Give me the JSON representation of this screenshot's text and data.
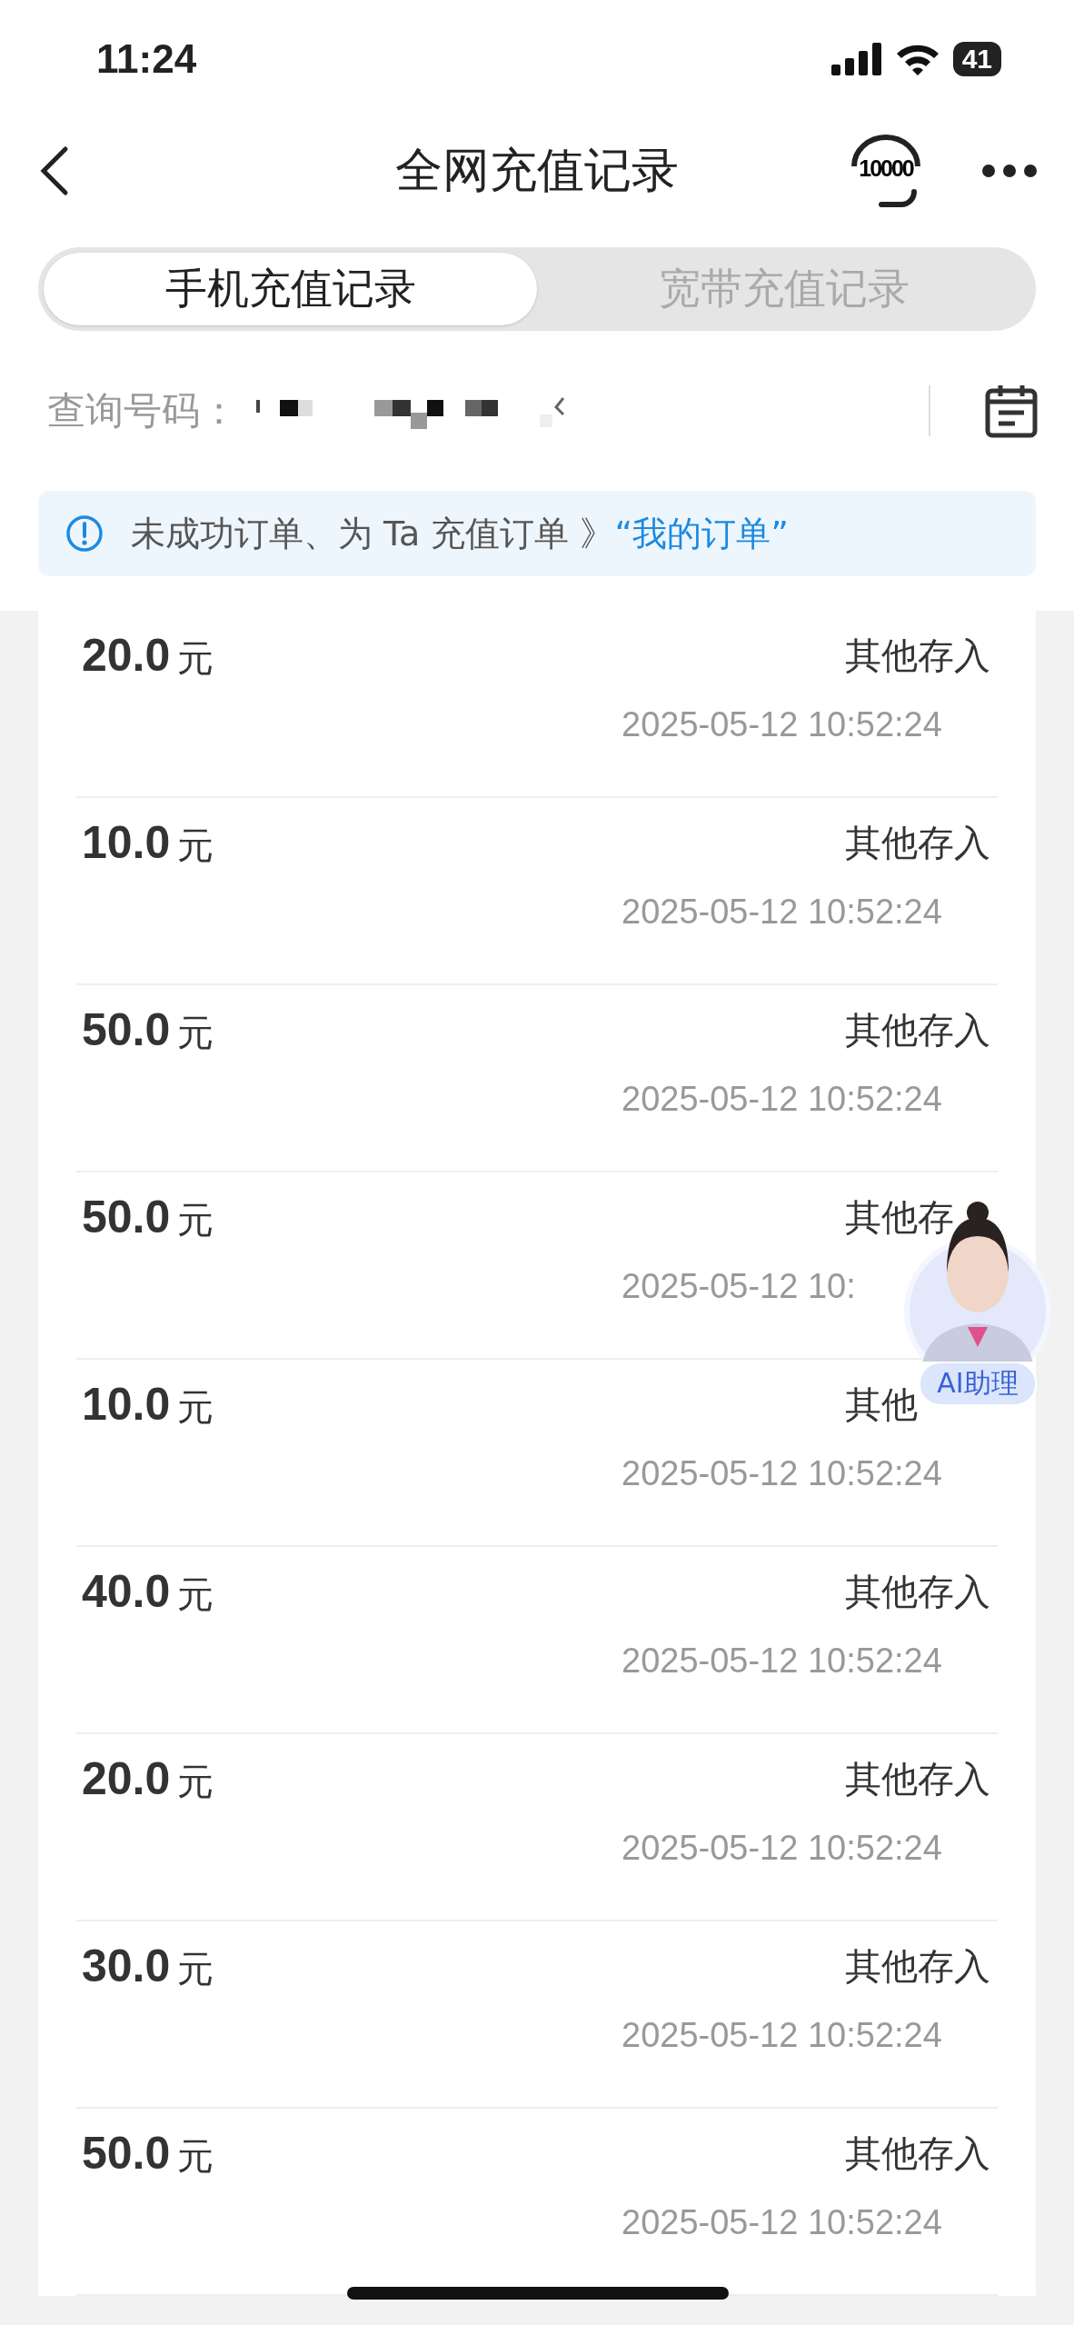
{
  "status_bar": {
    "time": "11:24",
    "battery": "41"
  },
  "header": {
    "title": "全网充值记录",
    "service_label": "10000"
  },
  "tabs": [
    {
      "label": "手机充值记录",
      "selected": true
    },
    {
      "label": "宽带充值记录",
      "selected": false
    }
  ],
  "query": {
    "label": "查询号码："
  },
  "notice": {
    "text": "未成功订单、为 Ta 充值订单 》",
    "link": "“我的订单”"
  },
  "records": [
    {
      "amount": "20.0",
      "unit": "元",
      "type": "其他存入",
      "time": "2025-05-12 10:52:24"
    },
    {
      "amount": "10.0",
      "unit": "元",
      "type": "其他存入",
      "time": "2025-05-12 10:52:24"
    },
    {
      "amount": "50.0",
      "unit": "元",
      "type": "其他存入",
      "time": "2025-05-12 10:52:24"
    },
    {
      "amount": "50.0",
      "unit": "元",
      "type": "其他存",
      "time": "2025-05-12 10:"
    },
    {
      "amount": "10.0",
      "unit": "元",
      "type": "其他",
      "time": "2025-05-12 10:52:24"
    },
    {
      "amount": "40.0",
      "unit": "元",
      "type": "其他存入",
      "time": "2025-05-12 10:52:24"
    },
    {
      "amount": "20.0",
      "unit": "元",
      "type": "其他存入",
      "time": "2025-05-12 10:52:24"
    },
    {
      "amount": "30.0",
      "unit": "元",
      "type": "其他存入",
      "time": "2025-05-12 10:52:24"
    },
    {
      "amount": "50.0",
      "unit": "元",
      "type": "其他存入",
      "time": "2025-05-12 10:52:24"
    }
  ],
  "assistant": {
    "label": "AI助理"
  }
}
